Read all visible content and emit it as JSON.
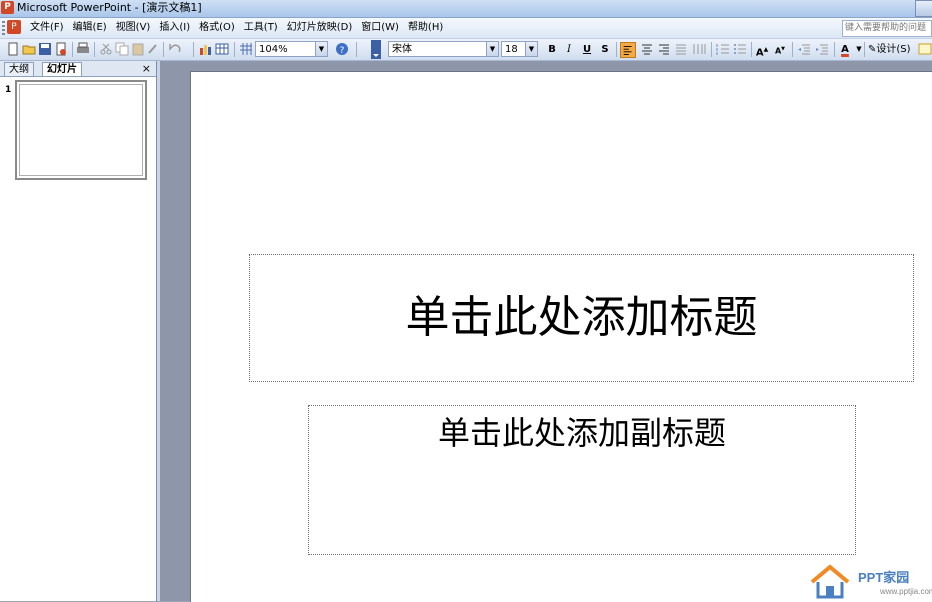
{
  "window": {
    "title": "Microsoft PowerPoint - [演示文稿1]"
  },
  "menu": {
    "items": [
      "文件(F)",
      "编辑(E)",
      "视图(V)",
      "插入(I)",
      "格式(O)",
      "工具(T)",
      "幻灯片放映(D)",
      "窗口(W)",
      "帮助(H)"
    ],
    "help_placeholder": "键入需要帮助的问题"
  },
  "toolbar": {
    "zoom": "104%",
    "font_name": "宋体",
    "font_size": "18",
    "bold": "B",
    "italic": "I",
    "underline": "U",
    "shadow": "S",
    "font_color": "A",
    "design_label": "设计(S)"
  },
  "left_pane": {
    "tabs": [
      "大纲",
      "幻灯片"
    ],
    "active_tab": "幻灯片",
    "close": "×",
    "slides": [
      {
        "number": "1"
      }
    ]
  },
  "slide": {
    "title_placeholder": "单击此处添加标题",
    "subtitle_placeholder": "单击此处添加副标题"
  },
  "watermark": {
    "text": "PPT家园",
    "url": "www.pptjia.com"
  },
  "colors": {
    "titlebar": "#a9c6ea",
    "workspace": "#8e96aa",
    "align_active": "#f5a945",
    "powerpoint_brand": "#d24726",
    "watermark": "#4a7fc1"
  }
}
